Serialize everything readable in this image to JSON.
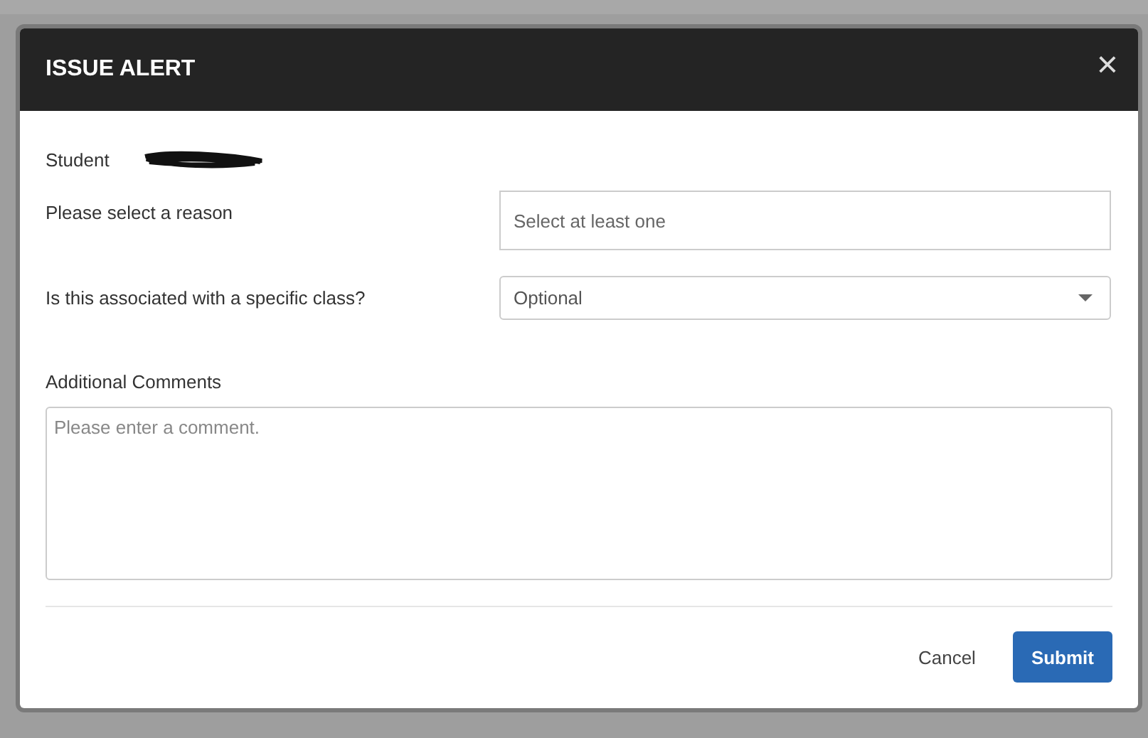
{
  "dialog": {
    "title": "ISSUE ALERT",
    "close": "×"
  },
  "student": {
    "label": "Student",
    "name_redacted": true
  },
  "fields": [
    {
      "kind": "text",
      "label": "Please select a reason",
      "placeholder": "Select at least one"
    },
    {
      "kind": "select",
      "label": "Is this associated with a specific class?",
      "placeholder": "Optional"
    }
  ],
  "comments": {
    "label": "Additional Comments",
    "placeholder": "Please enter a comment."
  },
  "buttons": [
    {
      "kind": "link",
      "label": "Cancel"
    },
    {
      "kind": "primary",
      "label": "Submit"
    }
  ]
}
